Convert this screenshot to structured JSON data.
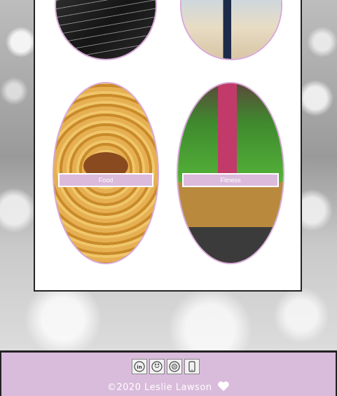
{
  "cards": [
    {
      "name": "code",
      "label": ""
    },
    {
      "name": "beach",
      "label": ""
    },
    {
      "name": "food",
      "label": "Food"
    },
    {
      "name": "fitness",
      "label": "Fitness"
    }
  ],
  "footer": {
    "icons": [
      "linkedin-icon",
      "github-icon",
      "codewars-icon",
      "phone-icon"
    ],
    "copyright": "©2020 Leslie Lawson",
    "heart": "heart-icon"
  },
  "colors": {
    "label_bg": "#dbbadc",
    "footer_bg": "#d9bbdb",
    "oval_border": "#d8a8d8"
  }
}
